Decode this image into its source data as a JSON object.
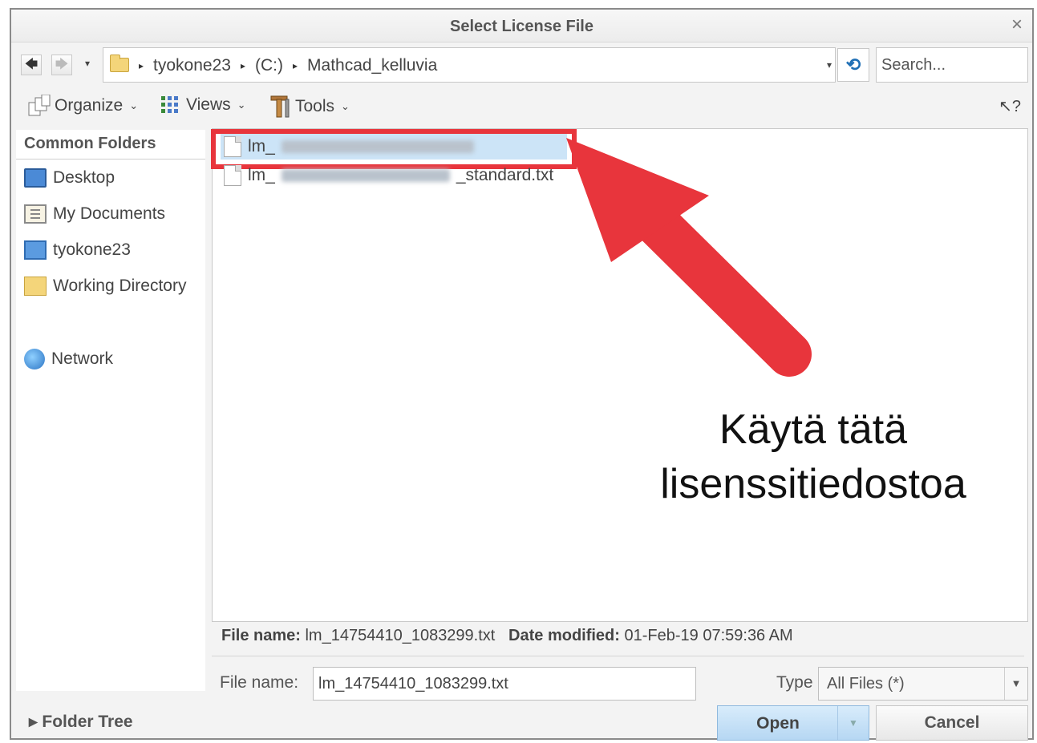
{
  "dialog": {
    "title": "Select License File",
    "close_glyph": "×"
  },
  "nav": {
    "back_glyph": "🡄",
    "forward_glyph": "🡆",
    "dropdown_glyph": "▾",
    "breadcrumb": [
      "tyokone23",
      "(C:)",
      "Mathcad_kelluvia"
    ],
    "breadcrumb_sep": "▸",
    "refresh_glyph": "⟲",
    "search_placeholder": "Search..."
  },
  "toolbar": {
    "organize": "Organize",
    "views": "Views",
    "tools": "Tools",
    "chevron": "⌄",
    "help_glyph": "↖?"
  },
  "sidebar": {
    "heading": "Common Folders",
    "items": [
      {
        "label": "Desktop",
        "icon": "desktop-icon"
      },
      {
        "label": "My Documents",
        "icon": "documents-icon"
      },
      {
        "label": "tyokone23",
        "icon": "computer-icon"
      },
      {
        "label": "Working Directory",
        "icon": "working-directory-icon"
      },
      {
        "label": "Network",
        "icon": "network-icon"
      }
    ],
    "folder_tree": "▸  Folder Tree"
  },
  "files": [
    {
      "prefix": "lm_",
      "suffix": "",
      "selected": true
    },
    {
      "prefix": "lm_",
      "suffix": "_standard.txt",
      "selected": false
    }
  ],
  "annotation": {
    "line1": "Käytä tätä",
    "line2": "lisenssitiedostoa",
    "color": "#e8353c"
  },
  "info": {
    "name_label": "File name:",
    "name_value": "lm_14754410_1083299.txt",
    "date_label": "Date modified:",
    "date_value": "01-Feb-19 07:59:36 AM"
  },
  "footer": {
    "file_name_label": "File name:",
    "file_name_value": "lm_14754410_1083299.txt",
    "type_label": "Type",
    "type_value": "All Files (*)",
    "type_arrow": "▼",
    "open_label": "Open",
    "open_split": "▼",
    "cancel_label": "Cancel"
  }
}
